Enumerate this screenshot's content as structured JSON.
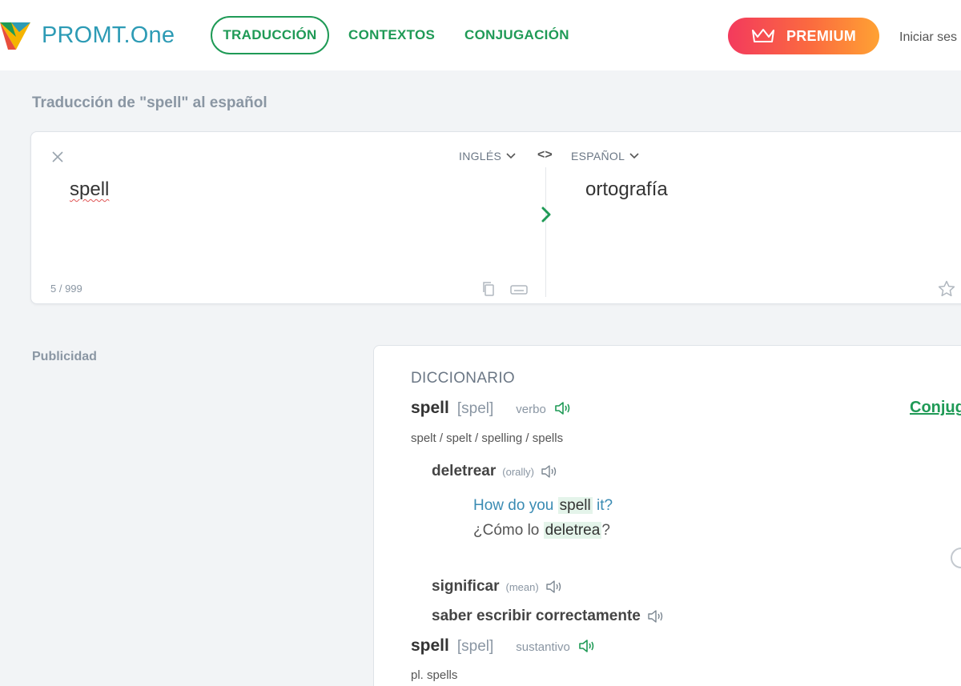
{
  "header": {
    "logo_text": "PROMT.One",
    "nav": [
      {
        "label": "TRADUCCIÓN",
        "active": true
      },
      {
        "label": "CONTEXTOS",
        "active": false
      },
      {
        "label": "CONJUGACIÓN",
        "active": false
      }
    ],
    "premium_label": "PREMIUM",
    "login_label": "Iniciar ses"
  },
  "page": {
    "title": "Traducción de \"spell\" al español",
    "ad_label": "Publicidad"
  },
  "translator": {
    "source_lang": "INGLÉS",
    "target_lang": "ESPAÑOL",
    "swap_label": "<>",
    "source_text": "spell",
    "target_text": "ortografía",
    "counter": "5 / 999"
  },
  "dictionary": {
    "title": "DICCIONARIO",
    "conjugation_link": "Conjug",
    "entries": [
      {
        "word": "spell",
        "transcription": "[spel]",
        "pos": "verbo",
        "forms": "spelt / spelt / spelling / spells",
        "translations": [
          {
            "word": "deletrear",
            "note": "(orally)",
            "example_en": {
              "pre": "How do you ",
              "hl": "spell",
              "post": " it?"
            },
            "example_es": {
              "pre": "¿Cómo lo ",
              "hl": "deletrea",
              "post": "?"
            }
          },
          {
            "word": "significar",
            "note": "(mean)"
          },
          {
            "word": "saber escribir correctamente",
            "note": ""
          }
        ]
      },
      {
        "word": "spell",
        "transcription": "[spel]",
        "pos": "sustantivo",
        "forms": "pl. spells"
      }
    ]
  },
  "colors": {
    "brand_green": "#1f9a56",
    "logo_blue": "#2d9bb5",
    "premium_gradient_start": "#f33a5d",
    "premium_gradient_end": "#ffa233"
  }
}
